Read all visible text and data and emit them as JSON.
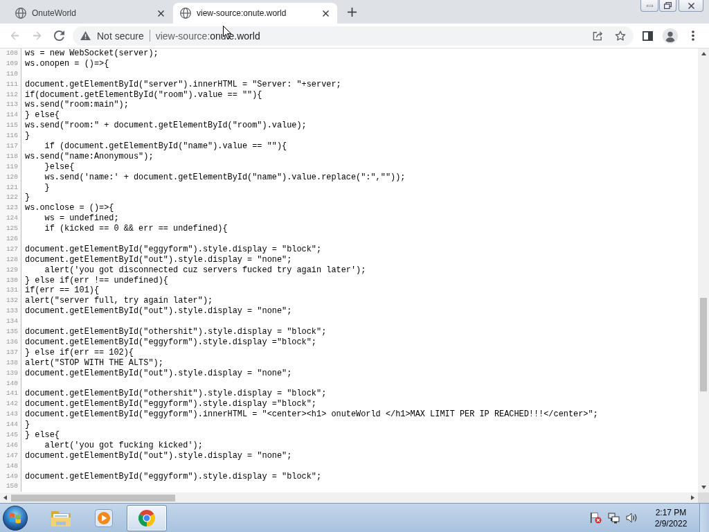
{
  "tabs": [
    {
      "title": "OnuteWorld",
      "selected": false
    },
    {
      "title": "view-source:onute.world",
      "selected": true
    }
  ],
  "toolbar": {
    "buttons": [
      {
        "kind": "back",
        "disabled": true
      },
      {
        "kind": "forward",
        "disabled": true
      },
      {
        "kind": "reload",
        "disabled": false
      }
    ],
    "security": "Not secure",
    "address": {
      "scheme": "view-source:",
      "host": "onute.world"
    }
  },
  "source": {
    "lines": [
      {
        "number": "108",
        "text": "ws = new WebSocket(server);"
      },
      {
        "number": "109",
        "text": "ws.onopen = ()=>{"
      },
      {
        "number": "110"
      },
      {
        "number": "111",
        "text": "document.getElementById(\"server\").innerHTML = \"Server: \"+server;"
      },
      {
        "number": "112",
        "text": "if(document.getElementById(\"room\").value == \"\"){"
      },
      {
        "number": "113",
        "text": "ws.send(\"room:main\");"
      },
      {
        "number": "114",
        "text": "} else{"
      },
      {
        "number": "115",
        "text": "ws.send(\"room:\" + document.getElementById(\"room\").value);"
      },
      {
        "number": "116",
        "text": "}"
      },
      {
        "number": "117",
        "text": "    if (document.getElementById(\"name\").value == \"\"){"
      },
      {
        "number": "118",
        "text": "ws.send(\"name:Anonymous\");"
      },
      {
        "number": "119",
        "text": "    }else{"
      },
      {
        "number": "120",
        "text": "    ws.send('name:' + document.getElementById(\"name\").value.replace(\":\",\"\"));"
      },
      {
        "number": "121",
        "text": "    }"
      },
      {
        "number": "122",
        "text": "}"
      },
      {
        "number": "123",
        "text": "ws.onclose = ()=>{"
      },
      {
        "number": "124",
        "text": "    ws = undefined;"
      },
      {
        "number": "125",
        "text": "    if (kicked == 0 && err == undefined){"
      },
      {
        "number": "126"
      },
      {
        "number": "127",
        "text": "document.getElementById(\"eggyform\").style.display = \"block\";"
      },
      {
        "number": "128",
        "text": "document.getElementById(\"out\").style.display = \"none\";"
      },
      {
        "number": "129",
        "text": "    alert('you got disconnected cuz servers fucked try again later');"
      },
      {
        "number": "130",
        "text": "} else if(err !== undefined){"
      },
      {
        "number": "131",
        "text": "if(err == 101){"
      },
      {
        "number": "132",
        "text": "alert(\"server full, try again later\");"
      },
      {
        "number": "133",
        "text": "document.getElementById(\"out\").style.display = \"none\";"
      },
      {
        "number": "134"
      },
      {
        "number": "135",
        "text": "document.getElementById(\"othershit\").style.display = \"block\";"
      },
      {
        "number": "136",
        "text": "document.getElementById(\"eggyform\").style.display =\"block\";"
      },
      {
        "number": "137",
        "text": "} else if(err == 102){"
      },
      {
        "number": "138",
        "text": "alert(\"STOP WITH THE ALTS\");"
      },
      {
        "number": "139",
        "text": "document.getElementById(\"out\").style.display = \"none\";"
      },
      {
        "number": "140"
      },
      {
        "number": "141",
        "text": "document.getElementById(\"othershit\").style.display = \"block\";"
      },
      {
        "number": "142",
        "text": "document.getElementById(\"eggyform\").style.display =\"block\";"
      },
      {
        "number": "143",
        "text": "document.getElementById(\"eggyform\").innerHTML = \"<center><h1> onuteWorld </h1>MAX LIMIT PER IP REACHED!!!</center>\";"
      },
      {
        "number": "144",
        "text": "}"
      },
      {
        "number": "145",
        "text": "} else{"
      },
      {
        "number": "146",
        "text": "    alert('you got fucking kicked');"
      },
      {
        "number": "147",
        "text": "document.getElementById(\"out\").style.display = \"none\";"
      },
      {
        "number": "148"
      },
      {
        "number": "149",
        "text": "document.getElementById(\"eggyform\").style.display = \"block\";"
      },
      {
        "number": "150"
      }
    ]
  },
  "taskbar": {
    "apps": [
      {
        "kind": "folder",
        "selected": false
      },
      {
        "kind": "media",
        "selected": false
      },
      {
        "kind": "browser",
        "selected": true
      }
    ],
    "clock": {
      "time": "2:17 PM",
      "date": "2/9/2022"
    }
  }
}
